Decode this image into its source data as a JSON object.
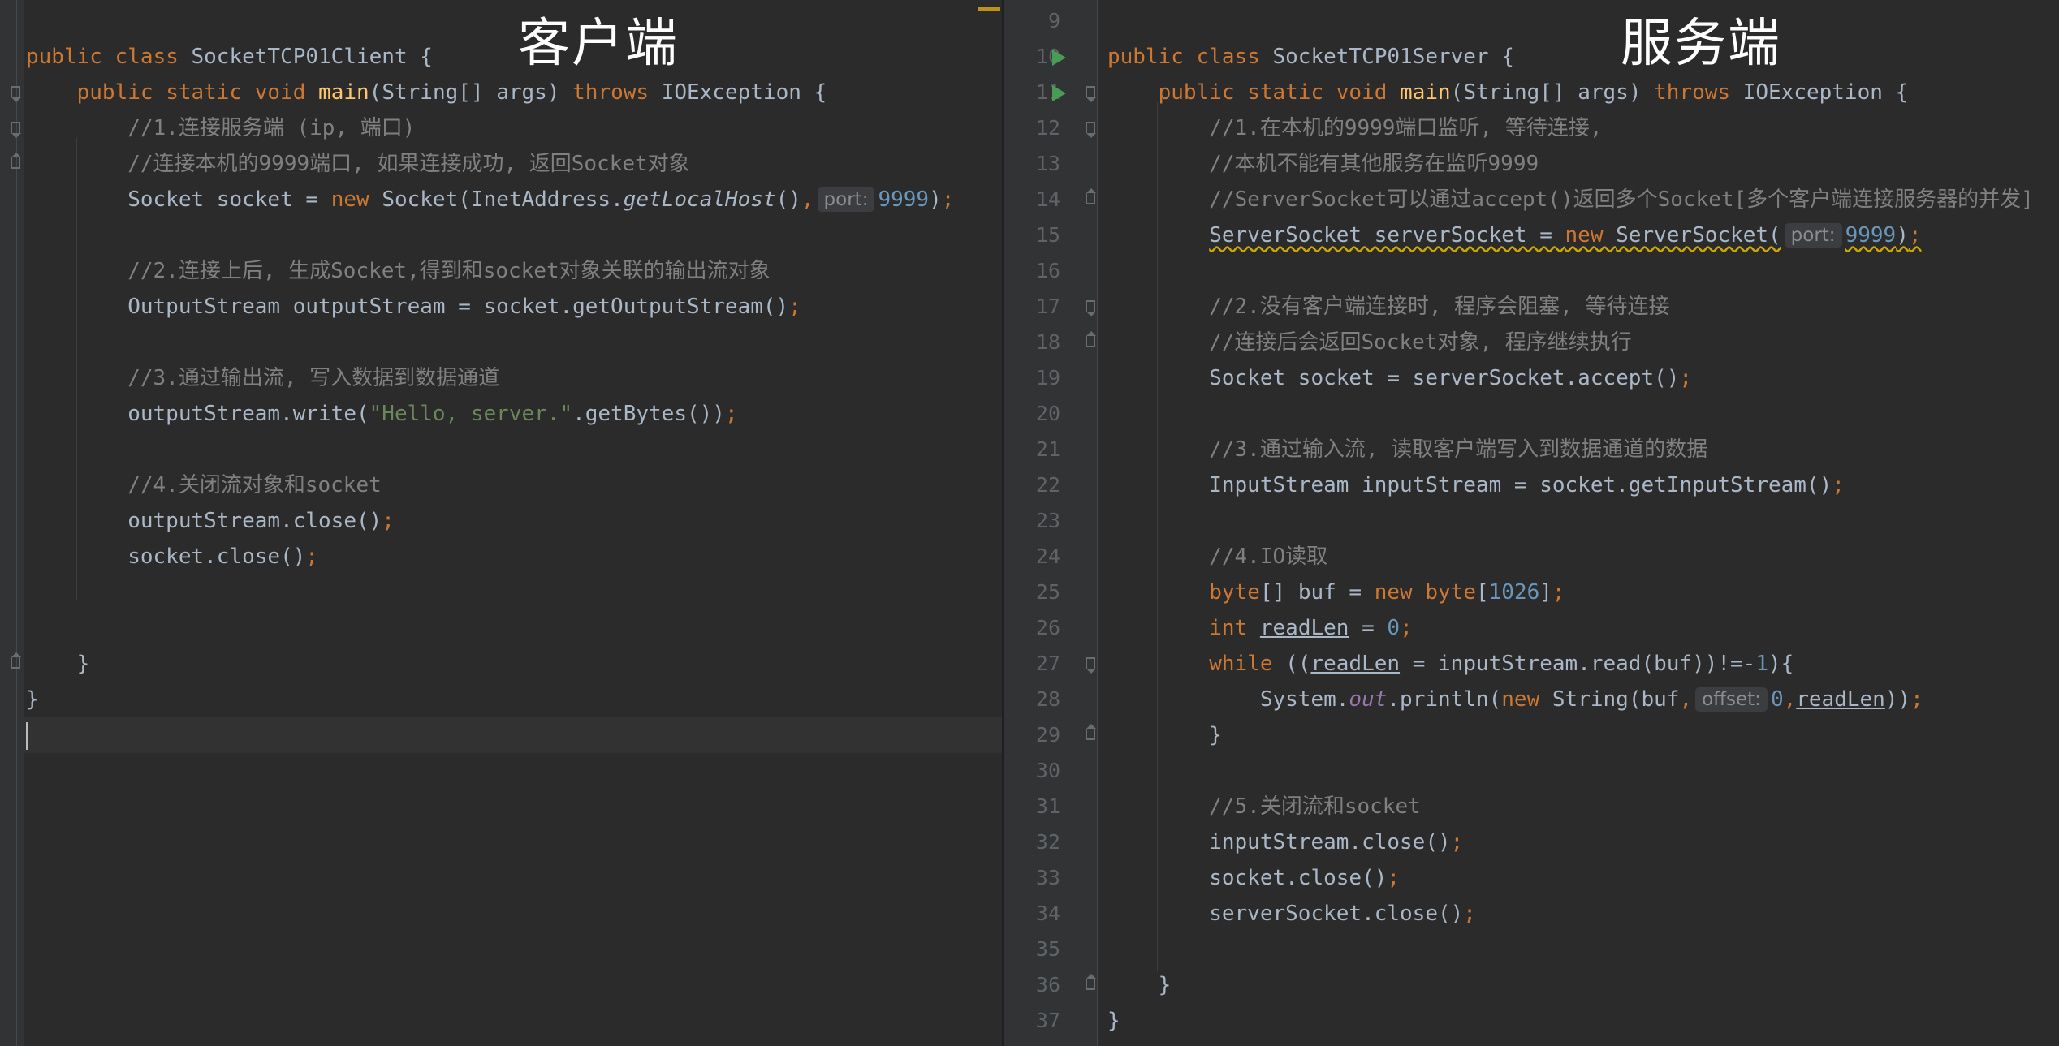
{
  "labels": {
    "client": "客户端",
    "server": "服务端"
  },
  "hints": {
    "port": "port:",
    "offset": "offset:"
  },
  "client": {
    "lines": [
      "public class SocketTCP01Client {",
      "    public static void main(String[] args) throws IOException {",
      "        //1.连接服务端 (ip, 端口)",
      "        //连接本机的9999端口, 如果连接成功, 返回Socket对象",
      "        Socket socket = new Socket(InetAddress.getLocalHost(), port: 9999);",
      "",
      "        //2.连接上后, 生成Socket,得到和socket对象关联的输出流对象",
      "        OutputStream outputStream = socket.getOutputStream();",
      "",
      "        //3.通过输出流, 写入数据到数据通道",
      "        outputStream.write(\"Hello, server.\".getBytes());",
      "",
      "        //4.关闭流对象和socket",
      "        outputStream.close();",
      "        socket.close();",
      "",
      "",
      "    }",
      "}"
    ]
  },
  "server": {
    "line_numbers": [
      "9",
      "10",
      "11",
      "12",
      "13",
      "14",
      "15",
      "16",
      "17",
      "18",
      "19",
      "20",
      "21",
      "22",
      "23",
      "24",
      "25",
      "26",
      "27",
      "28",
      "29",
      "30",
      "31",
      "32",
      "33",
      "34",
      "35",
      "36",
      "37"
    ],
    "lines": [
      "",
      "public class SocketTCP01Server {",
      "    public static void main(String[] args) throws IOException {",
      "        //1.在本机的9999端口监听, 等待连接,",
      "        //本机不能有其他服务在监听9999",
      "        //ServerSocket可以通过accept()返回多个Socket[多个客户端连接服务器的并发]",
      "        ServerSocket serverSocket = new ServerSocket( port: 9999);",
      "",
      "        //2.没有客户端连接时, 程序会阻塞, 等待连接",
      "        //连接后会返回Socket对象, 程序继续执行",
      "        Socket socket = serverSocket.accept();",
      "",
      "        //3.通过输入流, 读取客户端写入到数据通道的数据",
      "        InputStream inputStream = socket.getInputStream();",
      "",
      "        //4.IO读取",
      "        byte[] buf = new byte[1026];",
      "        int readLen = 0;",
      "        while ((readLen = inputStream.read(buf))!=-1){",
      "            System.out.println(new String(buf, offset: 0,readLen));",
      "        }",
      "",
      "        //5.关闭流和socket",
      "        inputStream.close();",
      "        socket.close();",
      "        serverSocket.close();",
      "",
      "    }",
      "}"
    ]
  }
}
